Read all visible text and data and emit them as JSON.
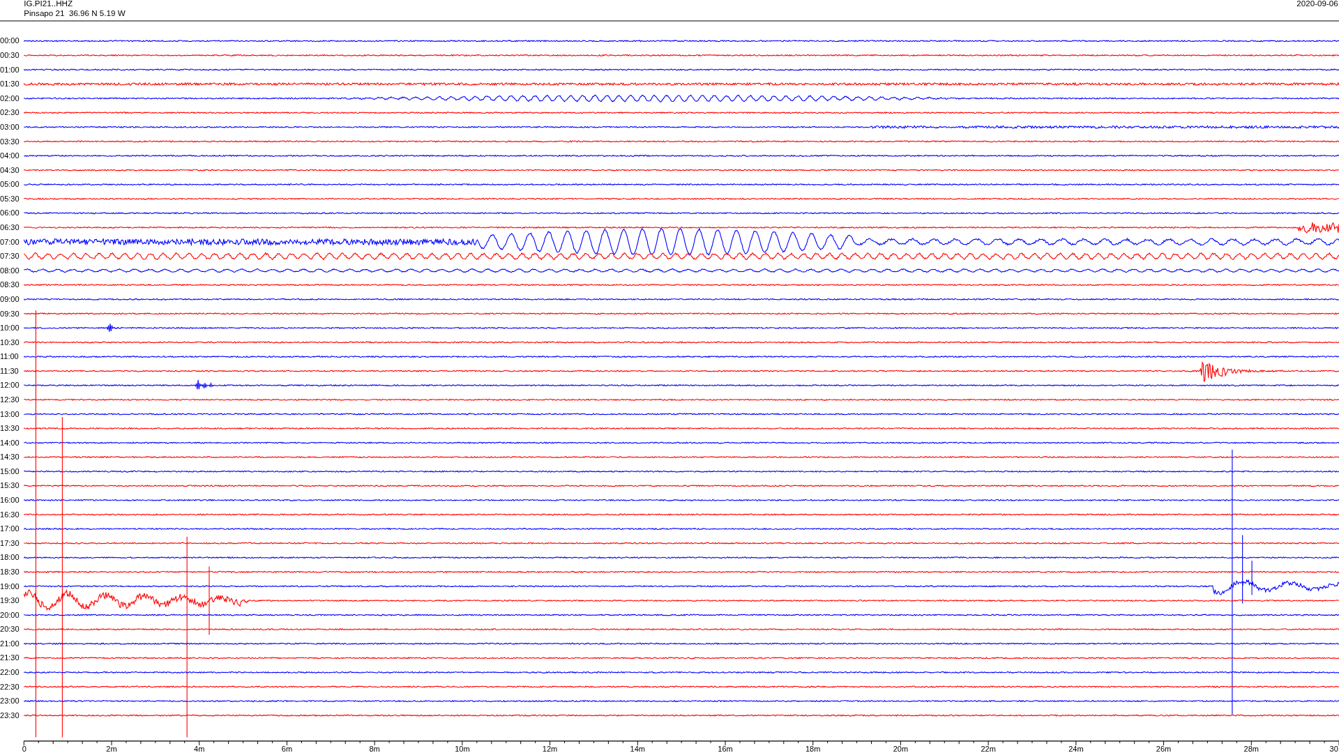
{
  "header": {
    "channel": "IG.PI21..HHZ",
    "station": "Pinsapo 21  36.96 N 5.19 W",
    "date": "2020-09-06"
  },
  "rows": [
    {
      "label": "00:00",
      "color": "#0000ff"
    },
    {
      "label": "00:30",
      "color": "#ff0000"
    },
    {
      "label": "01:00",
      "color": "#0000ff"
    },
    {
      "label": "01:30",
      "color": "#ff0000"
    },
    {
      "label": "02:00",
      "color": "#0000ff"
    },
    {
      "label": "02:30",
      "color": "#ff0000"
    },
    {
      "label": "03:00",
      "color": "#0000ff"
    },
    {
      "label": "03:30",
      "color": "#ff0000"
    },
    {
      "label": "04:00",
      "color": "#0000ff"
    },
    {
      "label": "04:30",
      "color": "#ff0000"
    },
    {
      "label": "05:00",
      "color": "#0000ff"
    },
    {
      "label": "05:30",
      "color": "#ff0000"
    },
    {
      "label": "06:00",
      "color": "#0000ff"
    },
    {
      "label": "06:30",
      "color": "#ff0000"
    },
    {
      "label": "07:00",
      "color": "#0000ff"
    },
    {
      "label": "07:30",
      "color": "#ff0000"
    },
    {
      "label": "08:00",
      "color": "#0000ff"
    },
    {
      "label": "08:30",
      "color": "#ff0000"
    },
    {
      "label": "09:00",
      "color": "#0000ff"
    },
    {
      "label": "09:30",
      "color": "#ff0000"
    },
    {
      "label": "10:00",
      "color": "#0000ff"
    },
    {
      "label": "10:30",
      "color": "#ff0000"
    },
    {
      "label": "11:00",
      "color": "#0000ff"
    },
    {
      "label": "11:30",
      "color": "#ff0000"
    },
    {
      "label": "12:00",
      "color": "#0000ff"
    },
    {
      "label": "12:30",
      "color": "#ff0000"
    },
    {
      "label": "13:00",
      "color": "#0000ff"
    },
    {
      "label": "13:30",
      "color": "#ff0000"
    },
    {
      "label": "14:00",
      "color": "#0000ff"
    },
    {
      "label": "14:30",
      "color": "#ff0000"
    },
    {
      "label": "15:00",
      "color": "#0000ff"
    },
    {
      "label": "15:30",
      "color": "#ff0000"
    },
    {
      "label": "16:00",
      "color": "#0000ff"
    },
    {
      "label": "16:30",
      "color": "#ff0000"
    },
    {
      "label": "17:00",
      "color": "#0000ff"
    },
    {
      "label": "17:30",
      "color": "#ff0000"
    },
    {
      "label": "18:00",
      "color": "#0000ff"
    },
    {
      "label": "18:30",
      "color": "#ff0000"
    },
    {
      "label": "19:00",
      "color": "#0000ff"
    },
    {
      "label": "19:30",
      "color": "#ff0000"
    },
    {
      "label": "20:00",
      "color": "#0000ff"
    },
    {
      "label": "20:30",
      "color": "#ff0000"
    },
    {
      "label": "21:00",
      "color": "#0000ff"
    },
    {
      "label": "21:30",
      "color": "#ff0000"
    },
    {
      "label": "22:00",
      "color": "#0000ff"
    },
    {
      "label": "22:30",
      "color": "#ff0000"
    },
    {
      "label": "23:00",
      "color": "#0000ff"
    },
    {
      "label": "23:30",
      "color": "#ff0000"
    }
  ],
  "x_axis": {
    "ticks": [
      "0",
      "2m",
      "4m",
      "6m",
      "8m",
      "10m",
      "12m",
      "14m",
      "16m",
      "18m",
      "20m",
      "22m",
      "24m",
      "26m",
      "28m",
      "30"
    ]
  }
}
